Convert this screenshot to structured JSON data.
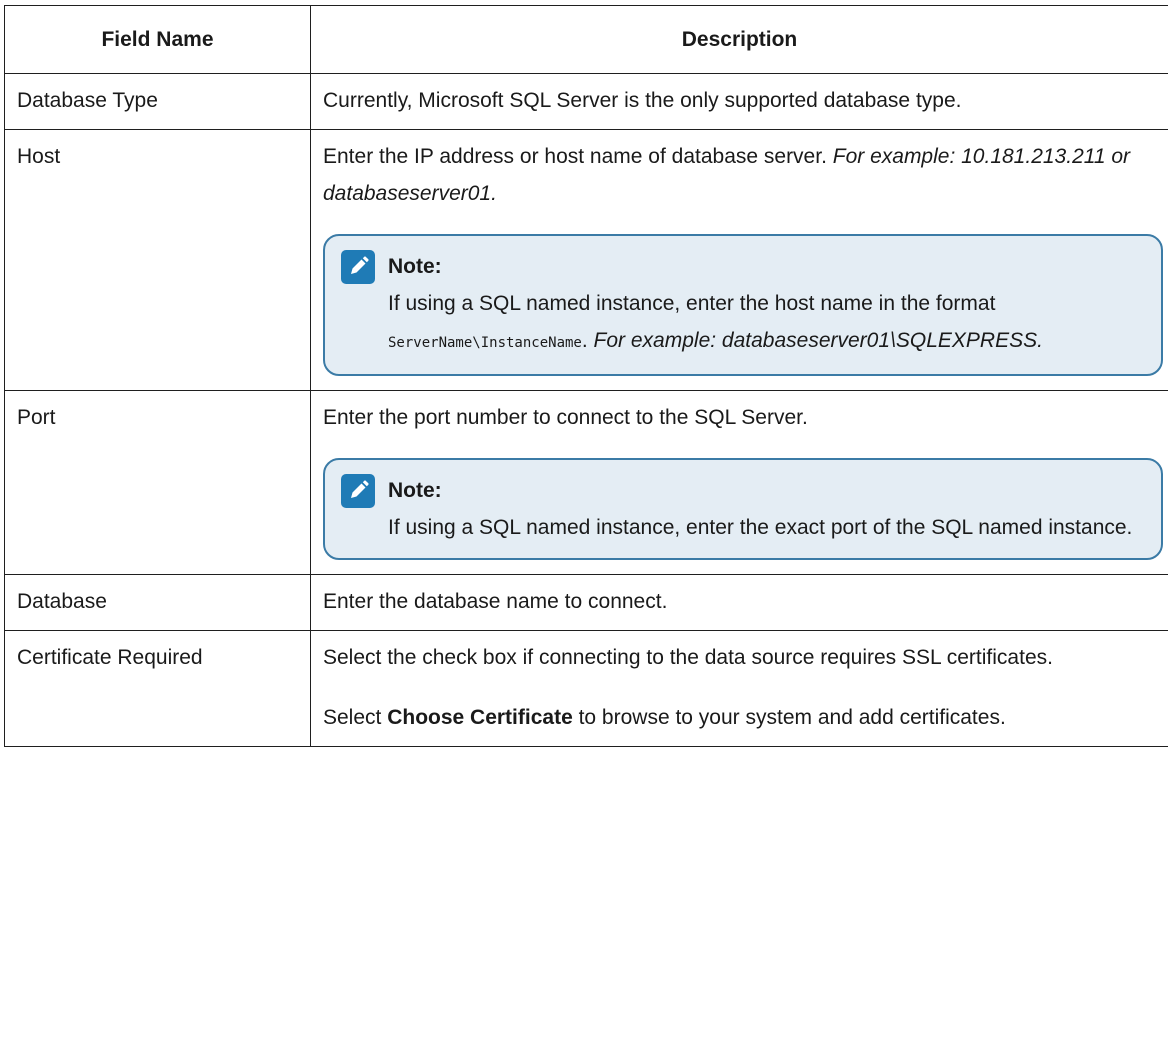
{
  "table": {
    "headers": {
      "field_name": "Field Name",
      "description": "Description"
    },
    "rows": {
      "database_type": {
        "field": "Database Type",
        "text": "Currently, Microsoft SQL Server is the only supported database type."
      },
      "host": {
        "field": "Host",
        "text": "Enter the IP address or host name of database server. ",
        "example": "For example: 10.181.213.211 or databaseserver01.",
        "note": {
          "title": "Note:",
          "text_before": "If using a SQL named instance, enter the host name in the for­mat ",
          "code": "ServerName\\InstanceName",
          "text_after": ". ",
          "example": "For example: databaseserv­er01\\SQLEXPRESS."
        }
      },
      "port": {
        "field": "Port",
        "text": "Enter the port number to connect to the SQL Server.",
        "note": {
          "title": "Note:",
          "text": "If using a SQL named instance, enter the exact port of the SQL named instance."
        }
      },
      "database": {
        "field": "Database",
        "text": "Enter the database name to connect."
      },
      "certificate_required": {
        "field": "Certificate Required",
        "text": "Select the check box if connecting to the data source requires SSL cer­tificates.",
        "text2_before": "Select ",
        "text2_bold": "Choose Certificate",
        "text2_after": " to browse to your system and add certifi­cates."
      }
    }
  },
  "colors": {
    "note_border": "#3b7ba6",
    "note_background": "#e4edf4",
    "note_icon": "#1f7bb6",
    "table_border": "#1f1f1f"
  },
  "icons": {
    "note": "pencil-note-icon"
  }
}
